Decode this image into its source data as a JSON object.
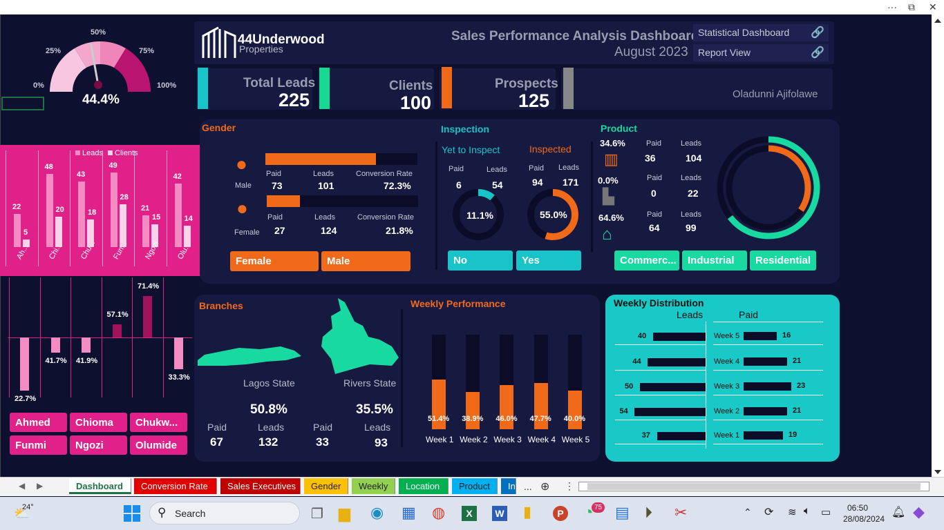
{
  "window": {
    "more": "···",
    "restore": "⧉",
    "close": "✕"
  },
  "gauge": {
    "l0": "0%",
    "l25": "25%",
    "l50": "50%",
    "l75": "75%",
    "l100": "100%",
    "value": "44.4%",
    "fraction": 0.444
  },
  "left_chart": {
    "legend_leads": "Leads",
    "legend_clients": "Clients",
    "names": [
      "Ah...",
      "Chi...",
      "Chu...",
      "Fun...",
      "Ngozi",
      "Olu..."
    ],
    "leads": [
      22,
      48,
      43,
      49,
      21,
      42
    ],
    "clients": [
      5,
      20,
      18,
      28,
      15,
      14
    ]
  },
  "rate_chart": {
    "values": [
      "22.7%",
      "41.7%",
      "41.9%",
      "57.1%",
      "71.4%",
      "33.3%"
    ]
  },
  "exec_buttons": [
    "Ahmed",
    "Chioma",
    "Chukw...",
    "Funmi",
    "Ngozi",
    "Olumide"
  ],
  "header": {
    "logo_line1": "44Underwood",
    "logo_line2": "Properties",
    "title": "Sales Performance Analysis Dashboard",
    "subtitle": "August 2023",
    "link1": "Statistical Dashboard",
    "link2": "Report View"
  },
  "kpis": {
    "leads_label": "Total Leads",
    "leads_value": "225",
    "clients_label": "Clients",
    "clients_value": "100",
    "prospects_label": "Prospects",
    "prospects_value": "125",
    "author": "Oladunni Ajifolawe"
  },
  "gender": {
    "title": "Gender",
    "male_label": "Male",
    "female_label": "Female",
    "paid": "Paid",
    "leads": "Leads",
    "conv": "Conversion Rate",
    "male_paid": "73",
    "male_leads": "101",
    "male_conv": "72.3%",
    "female_paid": "27",
    "female_leads": "124",
    "female_conv": "21.8%",
    "btn_female": "Female",
    "btn_male": "Male"
  },
  "inspection": {
    "title": "Inspection",
    "yet": "Yet to Inspect",
    "done": "Inspected",
    "paid": "Paid",
    "leads": "Leads",
    "yet_paid": "6",
    "yet_leads": "54",
    "yet_pct": "11.1%",
    "done_paid": "94",
    "done_leads": "171",
    "done_pct": "55.0%",
    "btn_no": "No",
    "btn_yes": "Yes"
  },
  "product": {
    "title": "Product",
    "paid": "Paid",
    "leads": "Leads",
    "c_pct": "34.6%",
    "c_paid": "36",
    "c_leads": "104",
    "i_pct": "0.0%",
    "i_paid": "0",
    "i_leads": "22",
    "r_pct": "64.6%",
    "r_paid": "64",
    "r_leads": "99",
    "btn_c": "Commerc...",
    "btn_i": "Industrial",
    "btn_r": "Residential"
  },
  "branches": {
    "title": "Branches",
    "lagos": "Lagos State",
    "rivers": "Rivers State",
    "lagos_pct": "50.8%",
    "rivers_pct": "35.5%",
    "paid": "Paid",
    "leads": "Leads",
    "lagos_paid": "67",
    "lagos_leads": "132",
    "rivers_paid": "33",
    "rivers_leads": "93"
  },
  "weekly_perf": {
    "title": "Weekly Performance",
    "weeks": [
      "Week 1",
      "Week 2",
      "Week 3",
      "Week 4",
      "Week 5"
    ],
    "pcts": [
      "51.4%",
      "38.9%",
      "46.0%",
      "47.7%",
      "40.0%"
    ],
    "values": [
      0.514,
      0.389,
      0.46,
      0.477,
      0.4
    ]
  },
  "weekly_dist": {
    "title": "Weekly Distribution",
    "leads": "Leads",
    "paid": "Paid",
    "rows": [
      {
        "week": "Week 5",
        "leads": "40",
        "paid": "16"
      },
      {
        "week": "Week 4",
        "leads": "44",
        "paid": "21"
      },
      {
        "week": "Week 3",
        "leads": "50",
        "paid": "23"
      },
      {
        "week": "Week 2",
        "leads": "54",
        "paid": "21"
      },
      {
        "week": "Week 1",
        "leads": "37",
        "paid": "19"
      }
    ]
  },
  "sheet_tabs": [
    "Dashboard",
    "Conversion Rate",
    "Sales Executives",
    "Gender",
    "Weekly",
    "Location",
    "Product",
    "Ins"
  ],
  "sheet_more": "...",
  "taskbar": {
    "temp": "24°",
    "search": "Search",
    "time": "06:50",
    "date": "28/08/2024",
    "whatsapp_badge": "75"
  }
}
